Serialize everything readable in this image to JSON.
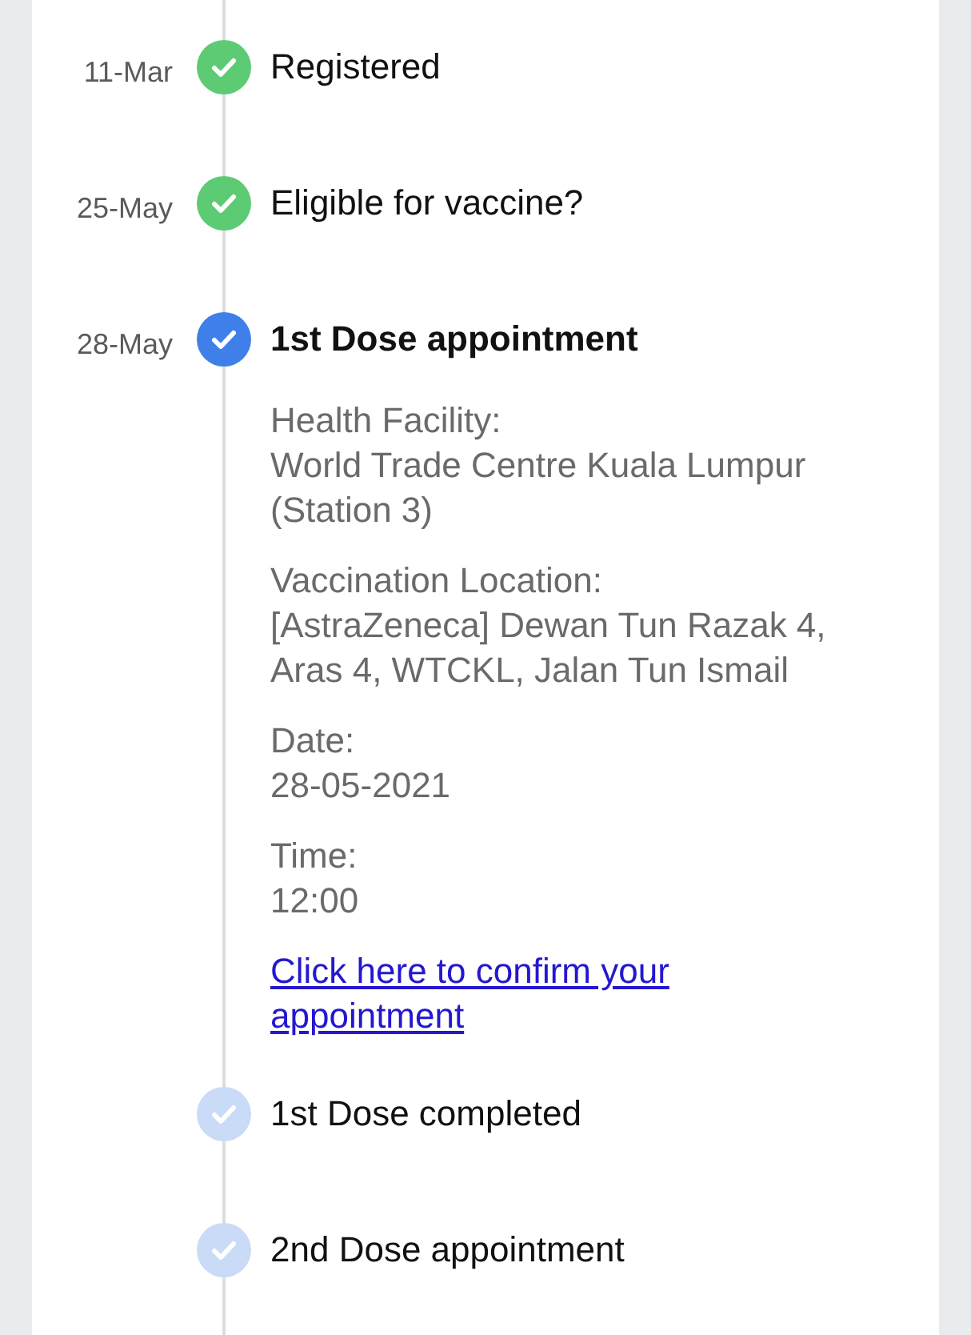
{
  "steps": [
    {
      "date": "11-Mar",
      "kind": "done",
      "title": "Registered"
    },
    {
      "date": "25-May",
      "kind": "done",
      "title": "Eligible for vaccine?"
    },
    {
      "date": "28-May",
      "kind": "current",
      "title": "1st Dose appointment",
      "details": [
        {
          "label": "Health Facility:",
          "value": "World Trade Centre Kuala Lumpur (Station 3)"
        },
        {
          "label": "Vaccination Location:",
          "value": "[AstraZeneca] Dewan Tun Razak 4, Aras 4, WTCKL, Jalan Tun Ismail"
        },
        {
          "label": "Date:",
          "value": "28-05-2021"
        },
        {
          "label": "Time:",
          "value": "12:00"
        }
      ],
      "link": "Click here to confirm your appointment"
    },
    {
      "kind": "pending",
      "title": "1st Dose completed"
    },
    {
      "kind": "pending",
      "title": "2nd Dose appointment"
    }
  ]
}
